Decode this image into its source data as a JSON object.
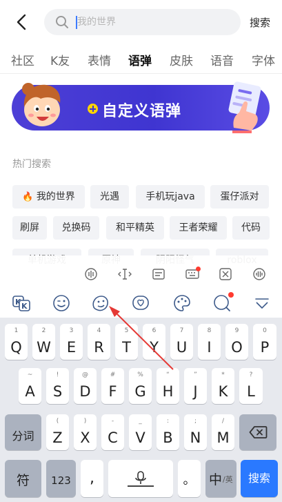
{
  "search": {
    "placeholder": "我的世界",
    "button": "搜索"
  },
  "tabs": [
    {
      "label": "社区"
    },
    {
      "label": "K友"
    },
    {
      "label": "表情"
    },
    {
      "label": "语弹"
    },
    {
      "label": "皮肤"
    },
    {
      "label": "语音"
    },
    {
      "label": "字体"
    }
  ],
  "banner": {
    "text": "自定义语弹"
  },
  "hot": {
    "title": "热门搜索",
    "chips": [
      {
        "label": "我的世界"
      },
      {
        "label": "光遇"
      },
      {
        "label": "手机玩java"
      },
      {
        "label": "蛋仔派对"
      },
      {
        "label": "刷屏"
      },
      {
        "label": "兑换码"
      },
      {
        "label": "和平精英"
      },
      {
        "label": "王者荣耀"
      },
      {
        "label": "代码"
      },
      {
        "label": "单机游戏"
      },
      {
        "label": "原神"
      },
      {
        "label": "阴阳怪气"
      },
      {
        "label": "roblox"
      }
    ]
  },
  "keyboard": {
    "row1": [
      {
        "sub": "1",
        "key": "Q"
      },
      {
        "sub": "2",
        "key": "W"
      },
      {
        "sub": "3",
        "key": "E"
      },
      {
        "sub": "4",
        "key": "R"
      },
      {
        "sub": "5",
        "key": "T"
      },
      {
        "sub": "6",
        "key": "Y"
      },
      {
        "sub": "7",
        "key": "U"
      },
      {
        "sub": "8",
        "key": "I"
      },
      {
        "sub": "9",
        "key": "O"
      },
      {
        "sub": "0",
        "key": "P"
      }
    ],
    "row2": [
      {
        "sub": "~",
        "key": "A"
      },
      {
        "sub": "!",
        "key": "S"
      },
      {
        "sub": "@",
        "key": "D"
      },
      {
        "sub": "#",
        "key": "F"
      },
      {
        "sub": "%",
        "key": "G"
      },
      {
        "sub": "“",
        "key": "H"
      },
      {
        "sub": "”",
        "key": "J"
      },
      {
        "sub": "*",
        "key": "K"
      },
      {
        "sub": "?",
        "key": "L"
      }
    ],
    "row3": [
      {
        "sub": "(",
        "key": "Z"
      },
      {
        "sub": ")",
        "key": "X"
      },
      {
        "sub": "-",
        "key": "C"
      },
      {
        "sub": "_",
        "key": "V"
      },
      {
        "sub": ":",
        "key": "B"
      },
      {
        "sub": ";",
        "key": "N"
      },
      {
        "sub": "/",
        "key": "M"
      }
    ],
    "fenci": "分词",
    "fu": "符",
    "num": "123",
    "comma": ",",
    "period": "。",
    "lang_main": "中",
    "lang_sub": "/英",
    "search": "搜索"
  },
  "colors": {
    "accent": "#2a79ff",
    "banner": "#4338d3",
    "highlight": "#ffd400",
    "arrow": "#e53935"
  }
}
